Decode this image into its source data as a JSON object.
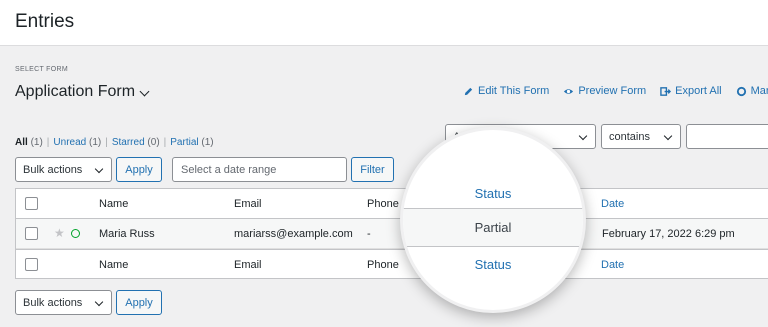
{
  "page": {
    "title": "Entries"
  },
  "form_select": {
    "label": "SELECT FORM",
    "name": "Application Form"
  },
  "form_actions": [
    {
      "label": "Edit This Form",
      "icon": "pencil-icon"
    },
    {
      "label": "Preview Form",
      "icon": "eye-icon"
    },
    {
      "label": "Export All",
      "icon": "export-icon"
    },
    {
      "label": "Mar",
      "icon": "circle-icon"
    }
  ],
  "filters": {
    "all": "All",
    "all_count": "(1)",
    "unread": "Unread",
    "unread_count": "(1)",
    "starred": "Starred",
    "starred_count": "(0)",
    "partial": "Partial",
    "partial_count": "(1)",
    "separator": "|"
  },
  "search": {
    "field": "Any form field",
    "operator": "contains",
    "value": ""
  },
  "bulk_top": {
    "label": "Bulk actions",
    "apply": "Apply"
  },
  "date_range": {
    "placeholder": "Select a date range",
    "filter": "Filter"
  },
  "table": {
    "columns": {
      "name": "Name",
      "email": "Email",
      "phone": "Phone",
      "status": "Status",
      "date": "Date"
    },
    "entry": {
      "name": "Maria Russ",
      "email": "mariarss@example.com",
      "phone": "-",
      "status": "Partial",
      "date": "February 17, 2022 6:29 pm"
    }
  },
  "bulk_bottom": {
    "label": "Bulk actions",
    "apply": "Apply"
  },
  "magnifier": {
    "header": "Status",
    "value": "Partial",
    "footer": "Status"
  },
  "colors": {
    "accent": "#2271b1",
    "background": "#f0f0f1",
    "unread_dot": "#00a32a"
  }
}
